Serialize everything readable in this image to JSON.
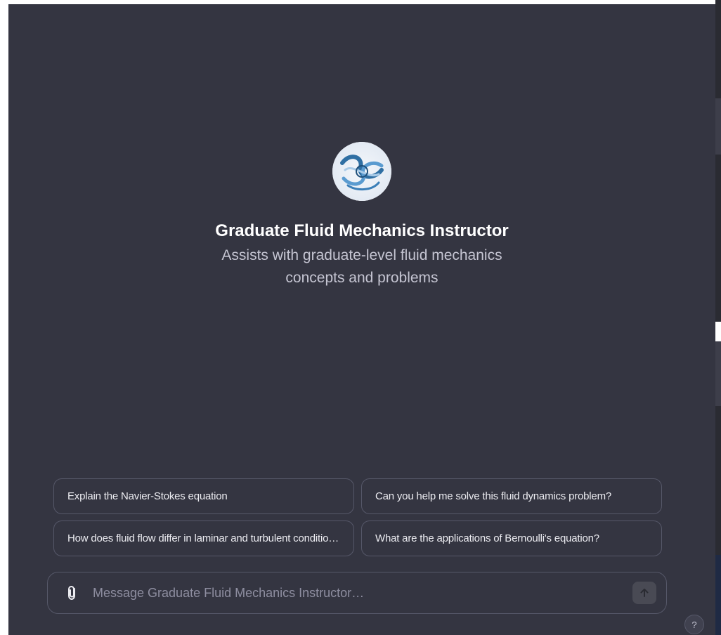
{
  "gpt": {
    "name": "Graduate Fluid Mechanics Instructor",
    "description": "Assists with graduate-level fluid mechanics concepts and problems",
    "avatar_icon": "fluid-swirl-avatar"
  },
  "suggestions": [
    {
      "label": "Explain the Navier-Stokes equation"
    },
    {
      "label": "Can you help me solve this fluid dynamics problem?"
    },
    {
      "label": "How does fluid flow differ in laminar and turbulent conditions?"
    },
    {
      "label": "What are the applications of Bernoulli's equation?"
    }
  ],
  "composer": {
    "placeholder": "Message Graduate Fluid Mechanics Instructor…",
    "attach_icon": "paperclip-icon",
    "send_icon": "arrow-up-icon"
  },
  "help": {
    "label": "?"
  },
  "colors": {
    "background": "#343541",
    "border": "#565869",
    "text": "#ececf1",
    "muted": "#c5c5d2"
  }
}
